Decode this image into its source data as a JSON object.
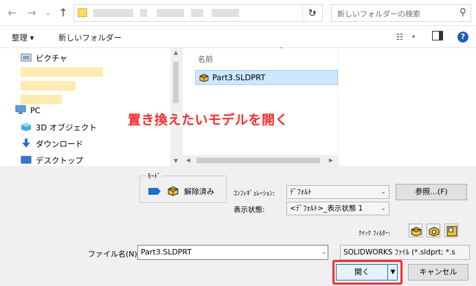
{
  "address_bar": {
    "back_icon": "arrow-left-icon",
    "forward_icon": "arrow-right-icon",
    "up_icon": "arrow-up-icon",
    "refresh_icon": "refresh-icon",
    "search_placeholder": "新しいフォルダーの検索"
  },
  "toolbar": {
    "organize": "整理 ▾",
    "new_folder": "新しいフォルダー"
  },
  "nav": {
    "items": [
      {
        "label": "ピクチャ",
        "icon": "pictures-icon"
      },
      {
        "label": "PC",
        "icon": "pc-icon"
      },
      {
        "label": "3D オブジェクト",
        "icon": "3d-objects-icon"
      },
      {
        "label": "ダウンロード",
        "icon": "download-icon"
      },
      {
        "label": "デスクトップ",
        "icon": "desktop-icon"
      }
    ]
  },
  "file_list": {
    "column_name": "名前",
    "files": [
      {
        "name": "Part3.SLDPRT",
        "icon": "solidworks-part-icon",
        "selected": true
      }
    ]
  },
  "annotation": "置き換えたいモデルを開く",
  "options": {
    "mode_legend": "ﾓｰﾄﾞ",
    "mode_value": "解除済み",
    "config_label": "ｺﾝﾌｨｷﾞｭﾚｰｼｮﾝ:",
    "config_value": "ﾃﾞﾌｫﾙﾄ",
    "display_state_label": "表示状態:",
    "display_state_value": "<ﾃﾞﾌｫﾙﾄ>_表示状態 1",
    "browse_button": "参照...(F)",
    "quick_filter_label": "ｸｲｯｸ ﾌｨﾙﾀｰ:"
  },
  "footer": {
    "filename_label": "ファイル名(N):",
    "filename_value": "Part3.SLDPRT",
    "filetype_value": "SOLIDWORKS ﾌｧｲﾙ (*.sldprt; *.s",
    "open_button": "開く",
    "cancel_button": "キャンセル"
  },
  "colors": {
    "accent": "#0078d7",
    "highlight": "#ff2a2a",
    "selection": "#cce8ff"
  }
}
